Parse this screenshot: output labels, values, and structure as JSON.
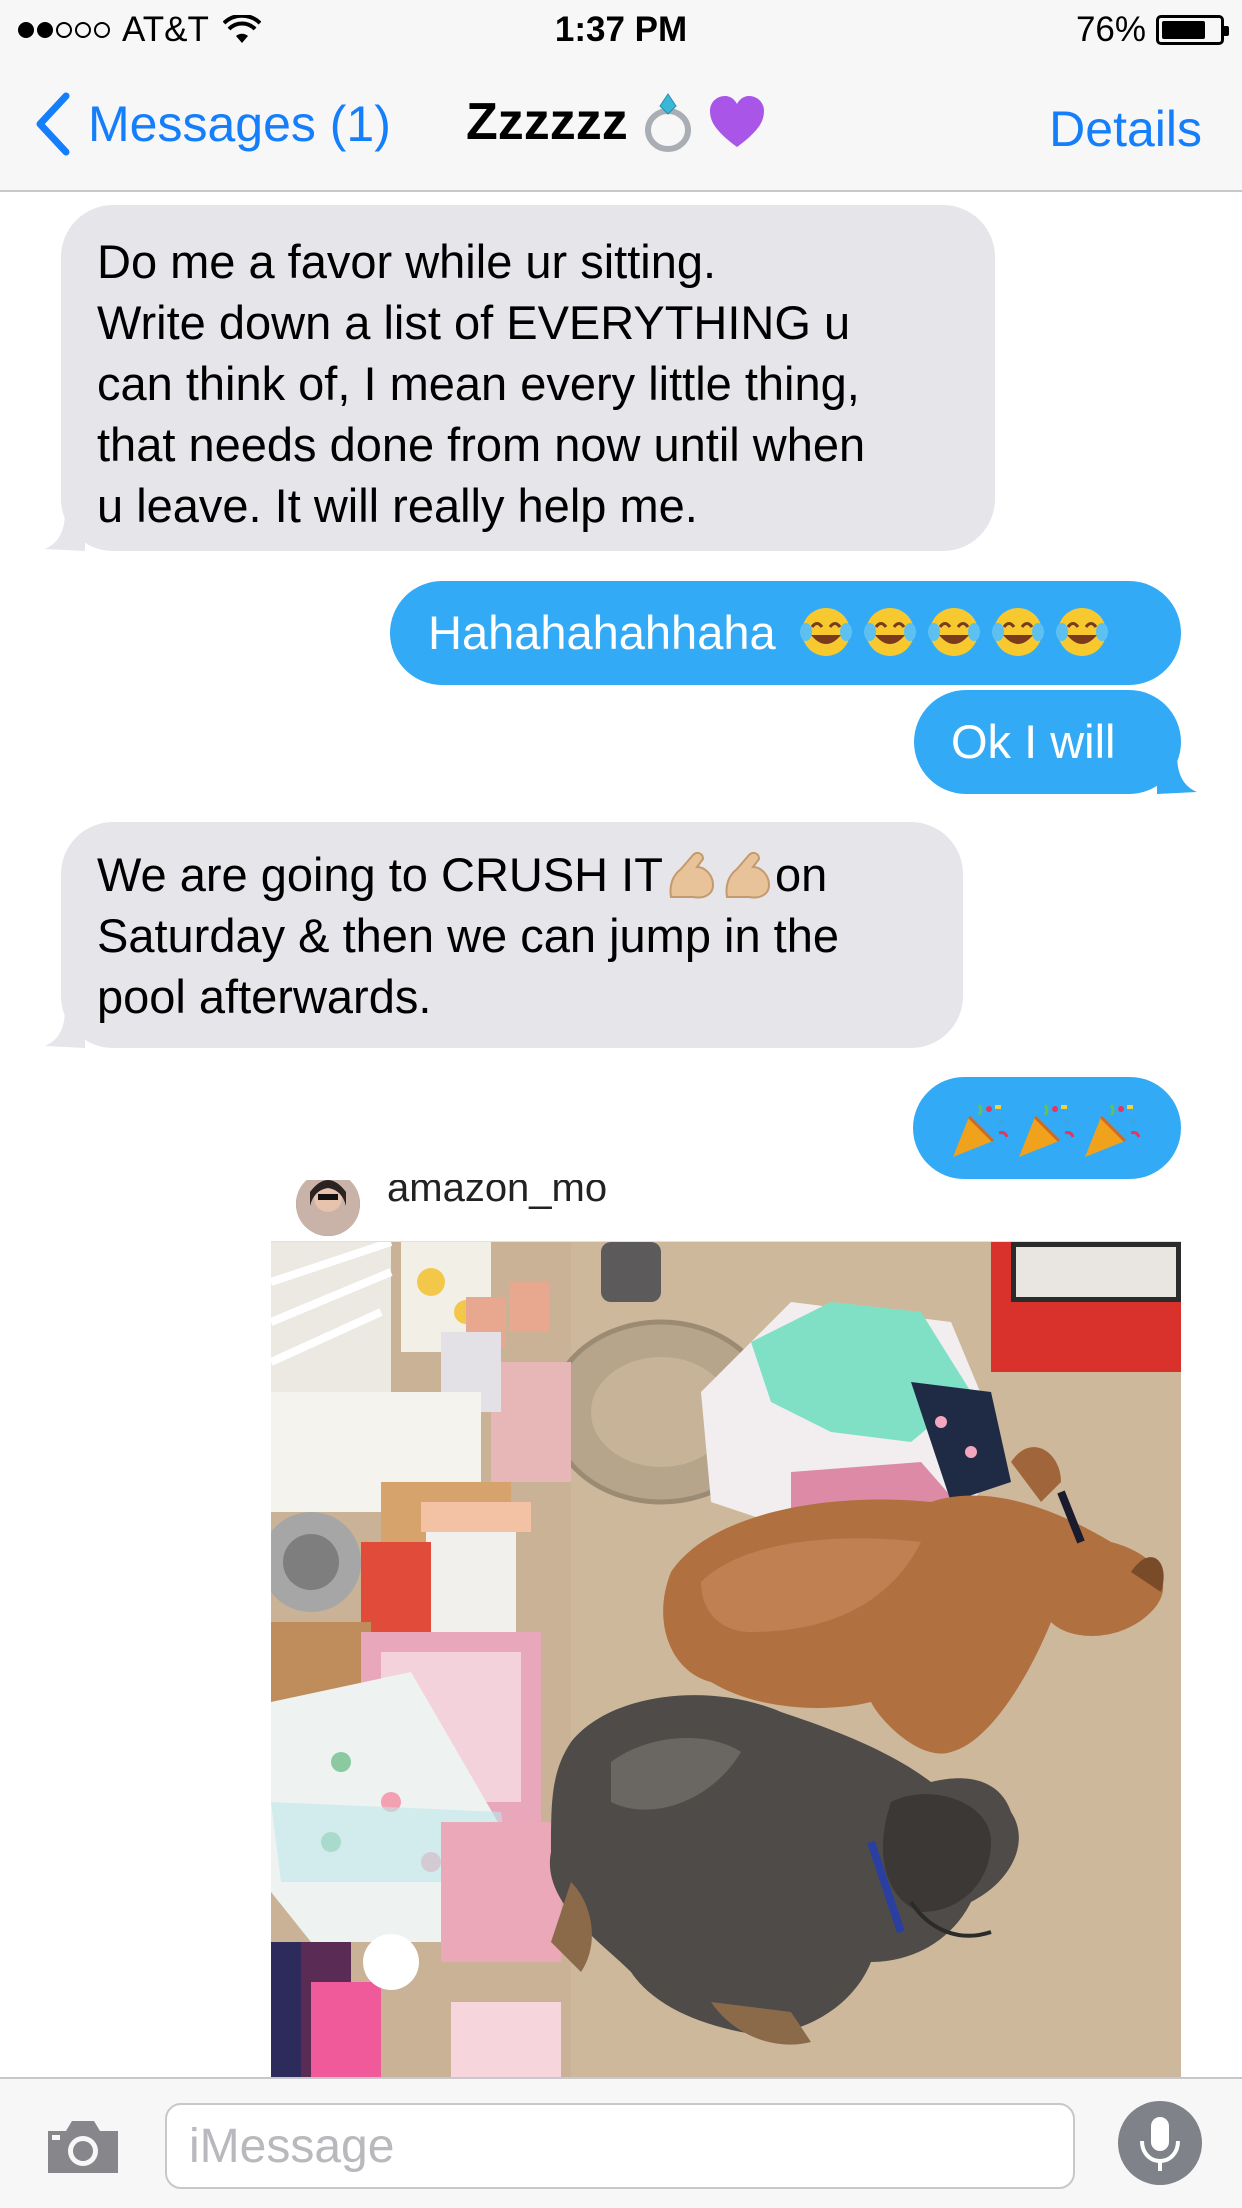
{
  "status_bar": {
    "carrier": "AT&T",
    "time": "1:37 PM",
    "battery_percent": "76%",
    "battery_level": 0.76,
    "signal_bars_filled": 2,
    "signal_bars_total": 5
  },
  "nav": {
    "back_label": "Messages (1)",
    "title": "Zzzzzz",
    "title_emojis": [
      "ring-icon",
      "purple-heart-icon"
    ],
    "details_label": "Details"
  },
  "messages": [
    {
      "direction": "incoming",
      "lines": [
        "Do me a favor while ur sitting.",
        "Write down a list of EVERYTHING u",
        "can think of, I mean every little thing,",
        "that needs done from now until when",
        "u leave. It will really help me."
      ]
    },
    {
      "direction": "outgoing",
      "text": "Hahahahahhaha",
      "emojis": [
        "tears-of-joy",
        "tears-of-joy",
        "tears-of-joy",
        "tears-of-joy",
        "tears-of-joy"
      ]
    },
    {
      "direction": "outgoing",
      "text": "Ok I will"
    },
    {
      "direction": "incoming",
      "line1_before": "We are going to CRUSH IT",
      "line1_after": "on",
      "line1_emojis": [
        "flexed-biceps",
        "flexed-biceps"
      ],
      "line2": "Saturday & then we can jump in the",
      "line3": "pool afterwards."
    },
    {
      "direction": "outgoing",
      "emojis": [
        "party-popper",
        "party-popper",
        "party-popper"
      ]
    }
  ],
  "attachment": {
    "username": "amazon_mo",
    "image_description_icon": "photo-of-dogs-sleeping-among-baby-items"
  },
  "input_bar": {
    "placeholder": "iMessage",
    "camera_icon": "camera-icon",
    "mic_icon": "microphone-icon"
  },
  "colors": {
    "accent_blue": "#147efb",
    "outgoing_bubble": "#33aaf5",
    "incoming_bubble": "#e5e5ea",
    "bar_background": "#f7f7f8"
  }
}
